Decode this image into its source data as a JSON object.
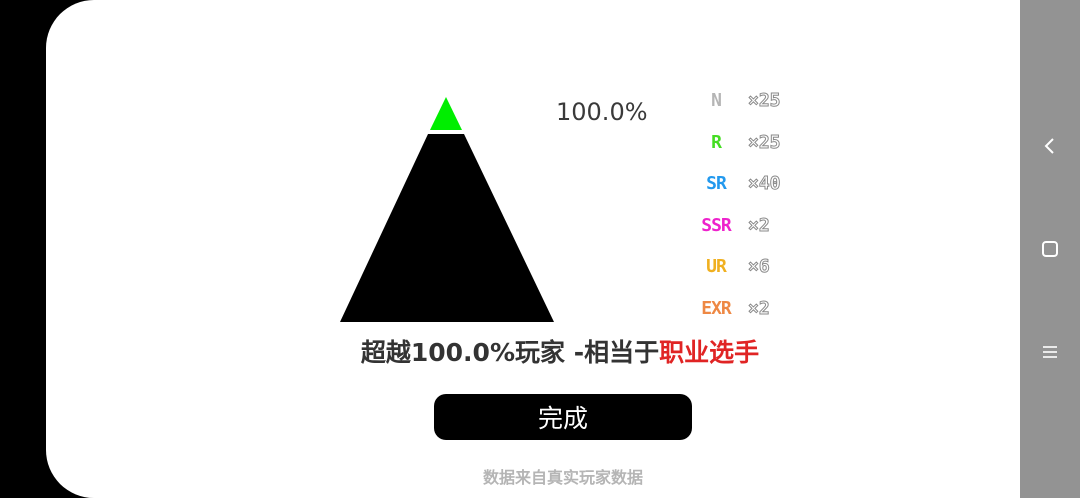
{
  "result": {
    "percentage": "100.0%",
    "summary_prefix": "超越100.0%玩家  -相当于",
    "summary_rank": "职业选手"
  },
  "pyramid": {
    "top_color": "#00ee00",
    "body_color": "#000000"
  },
  "legend": [
    {
      "rarity": "N",
      "count": "×25",
      "color": "#b5b5b5"
    },
    {
      "rarity": "R",
      "count": "×25",
      "color": "#44dd22"
    },
    {
      "rarity": "SR",
      "count": "×40",
      "color": "#2299ee"
    },
    {
      "rarity": "SSR",
      "count": "×2",
      "color": "#ee22cc"
    },
    {
      "rarity": "UR",
      "count": "×6",
      "color": "#f0b020"
    },
    {
      "rarity": "EXR",
      "count": "×2",
      "color": "#ee8844"
    }
  ],
  "done_label": "完成",
  "footnote": "数据来自真实玩家数据",
  "navbar": {
    "back_icon": "chevron-left-icon",
    "home_icon": "square-icon",
    "menu_icon": "menu-icon"
  }
}
